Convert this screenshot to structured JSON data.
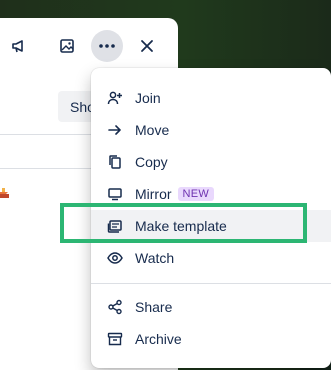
{
  "window": {
    "buttons": [
      "megaphone-icon",
      "image-icon",
      "more-icon",
      "close-icon"
    ],
    "show_button_label": "Sho"
  },
  "menu": {
    "items": [
      {
        "label": "Join",
        "icon": "person-add-icon"
      },
      {
        "label": "Move",
        "icon": "arrow-right-icon"
      },
      {
        "label": "Copy",
        "icon": "copy-icon"
      },
      {
        "label": "Mirror",
        "icon": "mirror-icon",
        "badge": "NEW"
      },
      {
        "label": "Make template",
        "icon": "template-icon"
      },
      {
        "label": "Watch",
        "icon": "eye-icon"
      },
      {
        "label": "Share",
        "icon": "share-icon"
      },
      {
        "label": "Archive",
        "icon": "archive-icon"
      }
    ]
  },
  "colors": {
    "highlight": "#2cb673",
    "badge_bg": "#e9d8fd",
    "badge_text": "#6e32b0",
    "text": "#172b4d"
  }
}
